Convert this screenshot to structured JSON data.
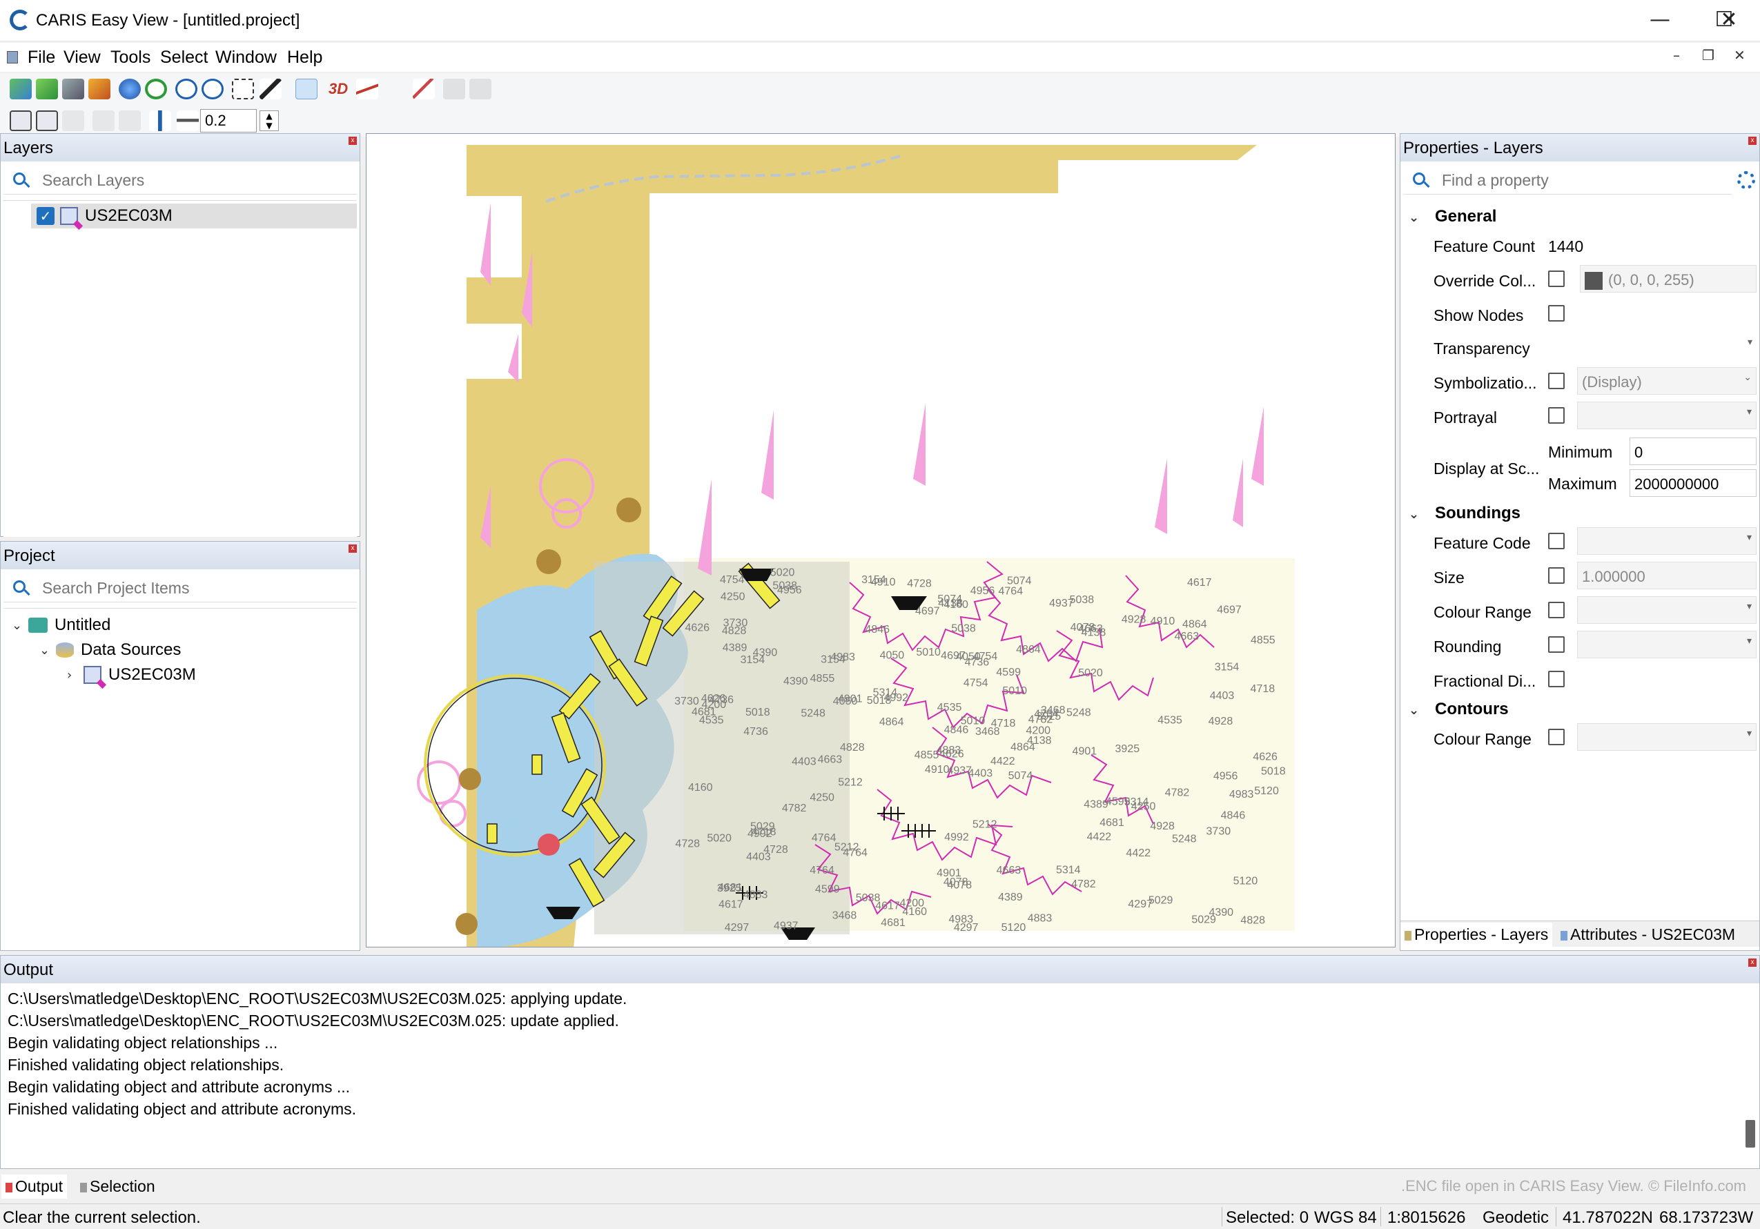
{
  "window": {
    "title": "CARIS Easy View - [untitled.project]",
    "minimize_glyph": "—",
    "maximize_glyph": "☐",
    "close_glyph": "✕"
  },
  "menu": [
    "File",
    "View",
    "Tools",
    "Select",
    "Window",
    "Help"
  ],
  "mdi_controls": [
    "–",
    "❐",
    "✕"
  ],
  "toolbar": {
    "icons": [
      "open-project-icon",
      "add-data-icon",
      "link-icon",
      "layers-icon",
      "globe-icon",
      "refresh-icon",
      "zoom-in-icon",
      "zoom-out-icon",
      "zoom-box-icon",
      "select-pointer-icon",
      "pan-hand-icon",
      "3d-icon",
      "profile-icon",
      "measure-icon",
      "stack-icon",
      "stack2-icon"
    ],
    "three_d_label": "3D",
    "tolerance_value": "0.2"
  },
  "layers_panel": {
    "title": "Layers",
    "search_placeholder": "Search Layers",
    "items": [
      {
        "label": "US2EC03M",
        "checked": true
      }
    ]
  },
  "project_panel": {
    "title": "Project",
    "search_placeholder": "Search Project Items",
    "tree": {
      "root": "Untitled",
      "data_sources": "Data Sources",
      "child": "US2EC03M"
    }
  },
  "properties_panel": {
    "title": "Properties - Layers",
    "search_placeholder": "Find a property",
    "sections": {
      "general": "General",
      "soundings": "Soundings",
      "contours": "Contours"
    },
    "general": {
      "feature_count_label": "Feature Count",
      "feature_count_value": "1440",
      "override_col_label": "Override Col...",
      "override_col_value": "(0, 0, 0, 255)",
      "show_nodes_label": "Show Nodes",
      "transparency_label": "Transparency",
      "symbolization_label": "Symbolizatio...",
      "symbolization_value": "(Display)",
      "portrayal_label": "Portrayal",
      "display_at_scale_label": "Display at Sc...",
      "minimum_label": "Minimum",
      "minimum_value": "0",
      "maximum_label": "Maximum",
      "maximum_value": "2000000000"
    },
    "soundings": {
      "feature_code_label": "Feature Code",
      "size_label": "Size",
      "size_value": "1.000000",
      "colour_range_label": "Colour Range",
      "rounding_label": "Rounding",
      "fractional_label": "Fractional Di..."
    },
    "contours": {
      "colour_range_label": "Colour Range"
    },
    "tabs": [
      "Properties - Layers",
      "Attributes - US2EC03M"
    ]
  },
  "output_panel": {
    "title": "Output",
    "lines": [
      "C:\\Users\\matledge\\Desktop\\ENC_ROOT\\US2EC03M\\US2EC03M.025: applying update.",
      "C:\\Users\\matledge\\Desktop\\ENC_ROOT\\US2EC03M\\US2EC03M.025: update applied.",
      "Begin validating object relationships ...",
      "Finished validating object relationships.",
      "Begin validating object and attribute acronyms ...",
      "Finished validating object and attribute acronyms."
    ],
    "tabs": [
      "Output",
      "Selection"
    ],
    "watermark": ".ENC file open in CARIS Easy View. © FileInfo.com"
  },
  "status_bar": {
    "message": "Clear the current selection.",
    "selected": "Selected: 0",
    "datum": "WGS 84",
    "scale": "1:8015626",
    "projection": "Geodetic",
    "latitude": "41.787022N",
    "longitude": "68.173723W"
  },
  "map": {
    "sounding_labels": [
      "4403",
      "3154",
      "4626",
      "4681",
      "4782",
      "4764",
      "5038",
      "4754",
      "4663",
      "4864",
      "4956",
      "4828",
      "4736",
      "4855",
      "4910",
      "5020",
      "4937",
      "4697",
      "5010",
      "4728",
      "4992",
      "4617",
      "4599",
      "4050",
      "3925",
      "4250",
      "4390",
      "4160",
      "4535",
      "4389",
      "4718",
      "4883",
      "4901",
      "4846",
      "4983",
      "4928",
      "5212",
      "5029",
      "5120",
      "5314",
      "5074",
      "5018",
      "5248",
      "4422",
      "3468",
      "3730",
      "4200",
      "4297",
      "4078",
      "4138"
    ],
    "colors": {
      "land": "#e6cf7a",
      "shallow": "#a7d0ea",
      "deep": "#fafae6",
      "magenta": "#d22bb2",
      "pink": "#f5a3dc"
    }
  }
}
